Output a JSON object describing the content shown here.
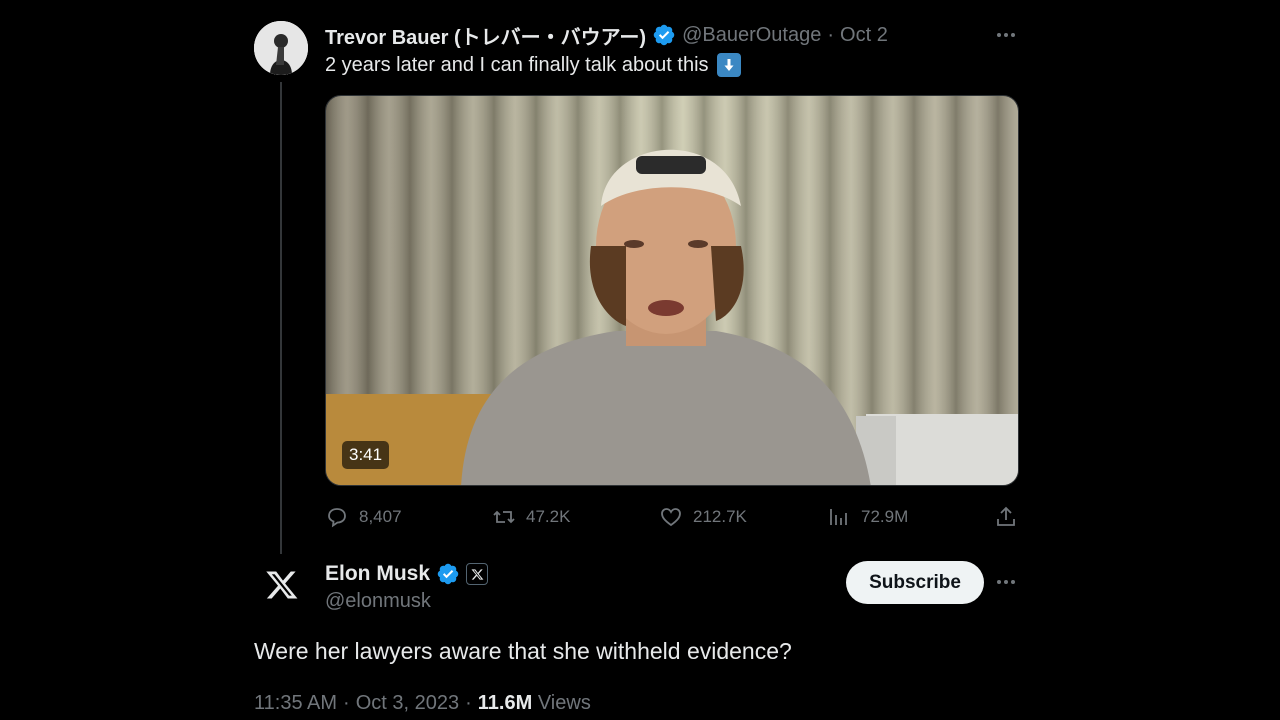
{
  "quoted_tweet": {
    "author_name": "Trevor Bauer (トレバー・バウアー)",
    "handle": "@BauerOutage",
    "separator": "·",
    "date": "Oct 2",
    "text": "2 years later and I can finally talk about this",
    "emoji_icon": "down-arrow-emoji-icon",
    "video_duration": "3:41",
    "stats": {
      "replies": "8,407",
      "retweets": "47.2K",
      "likes": "212.7K",
      "views": "72.9M"
    }
  },
  "main_tweet": {
    "author_name": "Elon Musk",
    "handle": "@elonmusk",
    "subscribe_label": "Subscribe",
    "text": "Were her lawyers aware that she withheld evidence?",
    "time": "11:35 AM",
    "separator": "·",
    "date": "Oct 3, 2023",
    "views_count": "11.6M",
    "views_label": "Views"
  },
  "colors": {
    "background": "#000000",
    "text_primary": "#e7e9ea",
    "text_secondary": "#71767b",
    "verified_blue": "#1d9bf0",
    "subscribe_bg": "#eff3f4"
  }
}
